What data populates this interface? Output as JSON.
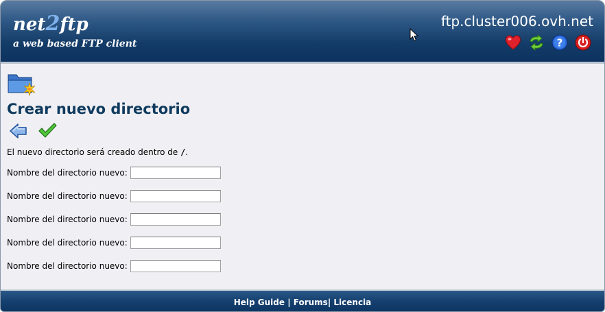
{
  "header": {
    "logo_part1": "net",
    "logo_part2": "2",
    "logo_part3": "ftp",
    "tagline": "a web based FTP client",
    "server": "ftp.cluster006.ovh.net",
    "icons": [
      "heart-icon",
      "refresh-icon",
      "help-icon",
      "power-icon"
    ]
  },
  "page": {
    "title": "Crear nuevo directorio",
    "notice_prefix": "El nuevo directorio será creado dentro de ",
    "notice_path": "/",
    "notice_suffix": ".",
    "field_label": "Nombre del directorio nuevo:",
    "fields": [
      "",
      "",
      "",
      "",
      ""
    ]
  },
  "actions": [
    "back-arrow-icon",
    "checkmark-icon"
  ],
  "footer": {
    "help": "Help Guide",
    "sep1": " | ",
    "forums": "Forums",
    "sep2": "| ",
    "license": "Licencia"
  },
  "colors": {
    "header_dark": "#0d3260",
    "title": "#0f3a5e",
    "background": "#f0f0f4"
  }
}
